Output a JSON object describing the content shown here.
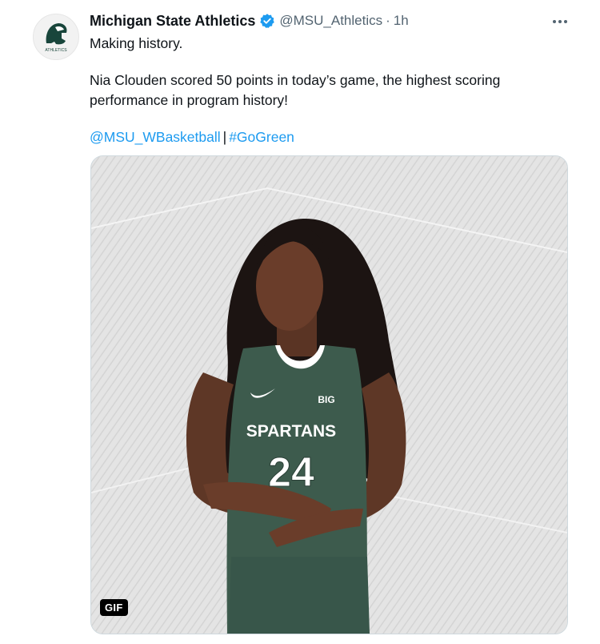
{
  "tweet": {
    "display_name": "Michigan State Athletics",
    "handle": "@MSU_Athletics",
    "separator": "·",
    "time": "1h",
    "line1": "Making history.",
    "line2": "Nia Clouden scored 50 points in today’s game, the highest scoring",
    "line3": "performance in program history!",
    "mention": "@MSU_WBasketball",
    "link_separator": "|",
    "hashtag": "#GoGreen",
    "avatar_text": "ATHLETICS"
  },
  "media": {
    "badge": "GIF",
    "jersey_brand": "BIG",
    "jersey_team": "SPARTANS",
    "jersey_number": "24"
  },
  "colors": {
    "link": "#1d9bf0",
    "verified": "#1d9bf0",
    "spartan_green": "#18453b",
    "jersey": "#3d5b4d"
  },
  "icons": {
    "verified": "verified-badge-icon",
    "more": "more-options-icon",
    "logo": "spartan-helmet-logo"
  }
}
